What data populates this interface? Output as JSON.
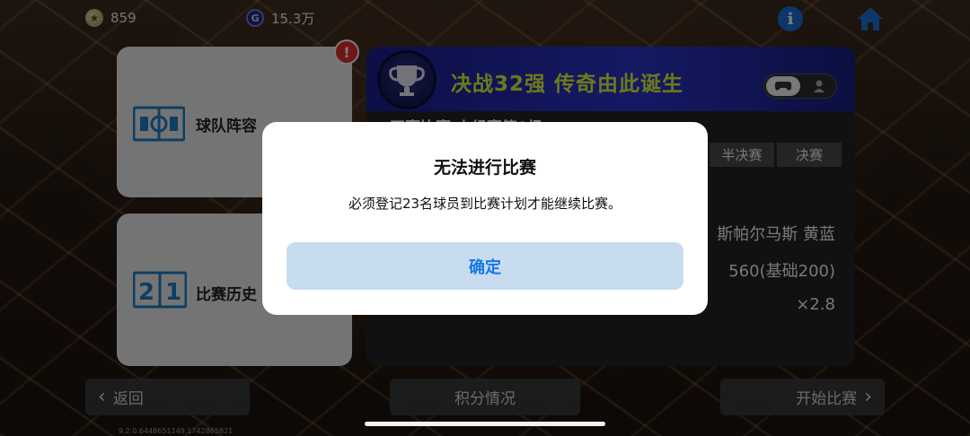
{
  "topbar": {
    "coins_icon": "star-coin-icon",
    "coins_value": "859",
    "gp_icon": "g-coin-icon",
    "gp_icon_glyph": "G",
    "gp_value": "15.3万",
    "info_icon": "info-icon",
    "info_glyph": "i",
    "home_icon": "home-icon"
  },
  "cards": {
    "team": {
      "label": "球队阵容",
      "icon": "formation-icon",
      "alert_glyph": "!"
    },
    "history": {
      "label": "比赛历史",
      "icon": "scoreboard-icon",
      "digit_left": "2",
      "digit_right": "1"
    }
  },
  "panel": {
    "title": "决战32强 传奇由此诞生",
    "subtitle": "正赛比赛 小组赛第1场",
    "tabs": [
      {
        "label": "半决赛"
      },
      {
        "label": "决赛"
      }
    ],
    "team_name": "斯帕尔马斯 黄蓝",
    "points": "560(基础200)",
    "multiplier": "×2.8"
  },
  "bottom": {
    "back_label": "返回",
    "score_label": "积分情况",
    "start_label": "开始比赛",
    "version": "9.2.0.6448651149.1742865821"
  },
  "dialog": {
    "title": "无法进行比赛",
    "message": "必须登记23名球员到比赛计划才能继续比赛。",
    "confirm_label": "确定"
  },
  "colors": {
    "accent_blue": "#1677e8",
    "title_yellow": "#d9f33a",
    "header_blue": "#2a33c7",
    "alert_red": "#e02c2c"
  }
}
